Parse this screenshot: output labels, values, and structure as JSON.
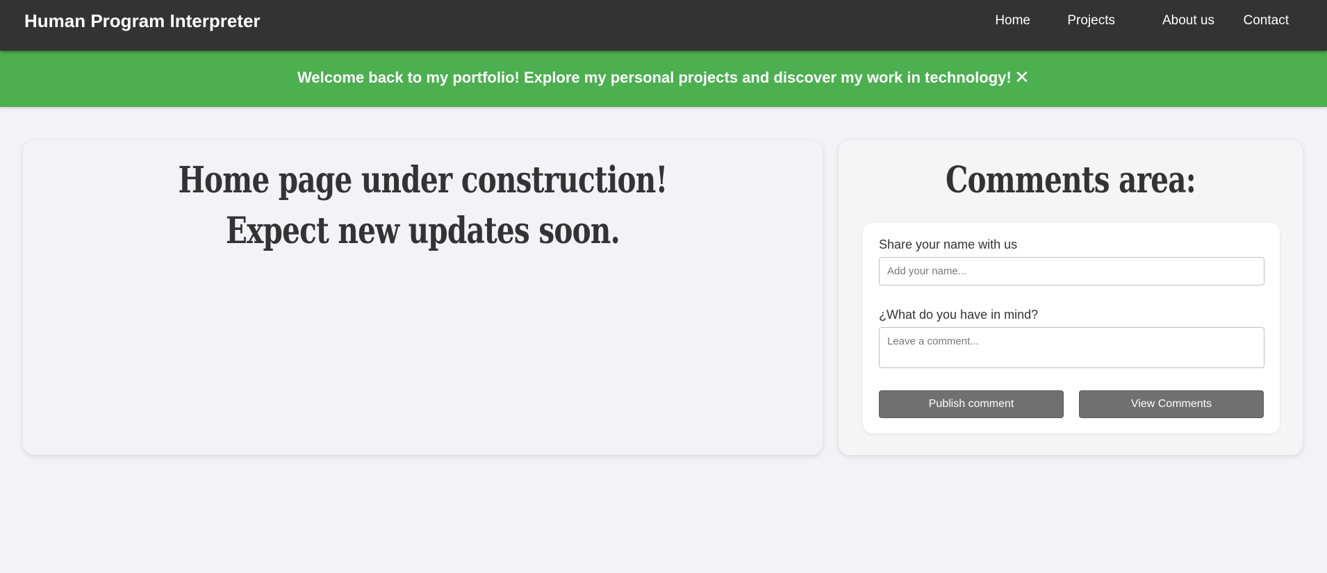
{
  "header": {
    "brand": "Human Program Interpreter",
    "nav": [
      {
        "label": "Home"
      },
      {
        "label": "Projects"
      },
      {
        "label": "About us"
      },
      {
        "label": "Contact"
      }
    ]
  },
  "banner": {
    "message": "Welcome back to my portfolio! Explore my personal projects and discover my work in technology!",
    "close_symbol": "✕",
    "color": "#4caf50"
  },
  "main": {
    "headline_1": "Home page under construction!",
    "headline_2": "Expect new updates soon."
  },
  "comments": {
    "title": "Comments area:",
    "name_label": "Share your name with us",
    "name_placeholder": "Add your name...",
    "name_value": "",
    "comment_label": "¿What do you have in mind?",
    "comment_placeholder": "Leave a comment...",
    "comment_value": "",
    "publish_label": "Publish comment",
    "view_label": "View Comments"
  },
  "colors": {
    "header_bg": "#333333",
    "page_bg": "#f3f3f7",
    "button_bg": "#707070"
  }
}
